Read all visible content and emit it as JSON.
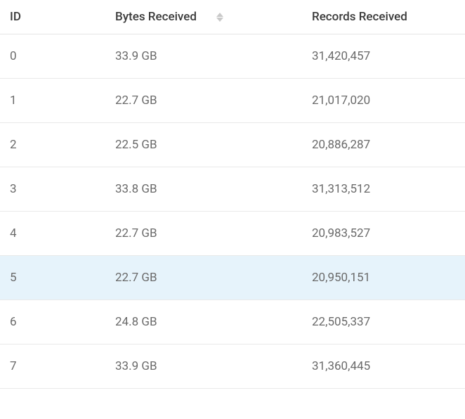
{
  "table": {
    "headers": {
      "id": "ID",
      "bytes": "Bytes Received",
      "records": "Records Received"
    },
    "rows": [
      {
        "id": "0",
        "bytes": "33.9 GB",
        "records": "31,420,457",
        "highlight": false
      },
      {
        "id": "1",
        "bytes": "22.7 GB",
        "records": "21,017,020",
        "highlight": false
      },
      {
        "id": "2",
        "bytes": "22.5 GB",
        "records": "20,886,287",
        "highlight": false
      },
      {
        "id": "3",
        "bytes": "33.8 GB",
        "records": "31,313,512",
        "highlight": false
      },
      {
        "id": "4",
        "bytes": "22.7 GB",
        "records": "20,983,527",
        "highlight": false
      },
      {
        "id": "5",
        "bytes": "22.7 GB",
        "records": "20,950,151",
        "highlight": true
      },
      {
        "id": "6",
        "bytes": "24.8 GB",
        "records": "22,505,337",
        "highlight": false
      },
      {
        "id": "7",
        "bytes": "33.9 GB",
        "records": "31,360,445",
        "highlight": false
      }
    ]
  }
}
